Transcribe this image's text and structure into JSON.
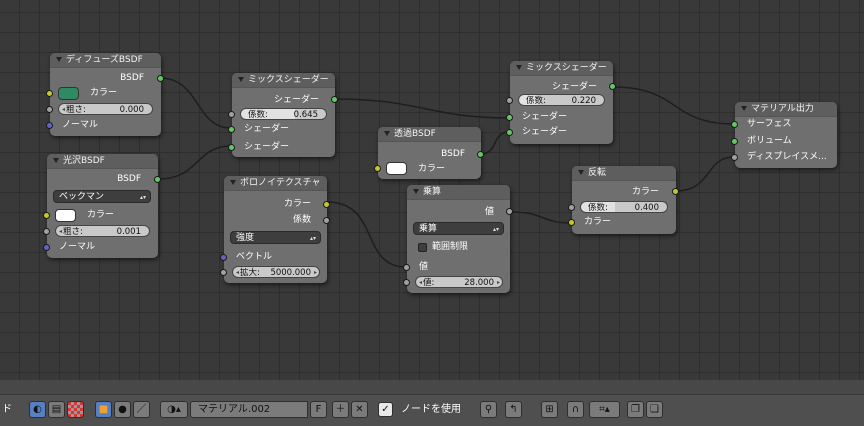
{
  "nodes": {
    "diffuse": {
      "title": "ディフューズBSDF",
      "out_bsdf": "BSDF",
      "color_label": "カラー",
      "color_value": "#2f8a62",
      "rough_label": "粗さ:",
      "rough_value": "0.000",
      "normal_label": "ノーマル"
    },
    "glossy": {
      "title": "光沢BSDF",
      "out_bsdf": "BSDF",
      "dist_value": "ベックマン",
      "color_label": "カラー",
      "color_value": "#ffffff",
      "rough_label": "粗さ:",
      "rough_value": "0.001",
      "normal_label": "ノーマル"
    },
    "mix1": {
      "title": "ミックスシェーダー",
      "out_shader": "シェーダー",
      "fac_label": "係数:",
      "fac_value": "0.645",
      "in_shader1": "シェーダー",
      "in_shader2": "シェーダー"
    },
    "transparent": {
      "title": "透過BSDF",
      "out_bsdf": "BSDF",
      "color_label": "カラー",
      "color_value": "#ffffff"
    },
    "mix2": {
      "title": "ミックスシェーダー",
      "out_shader": "シェーダー",
      "fac_label": "係数:",
      "fac_value": "0.220",
      "in_shader1": "シェーダー",
      "in_shader2": "シェーダー"
    },
    "output": {
      "title": "マテリアル出力",
      "in_surface": "サーフェス",
      "in_volume": "ボリューム",
      "in_displacement": "ディスプレイスメ..."
    },
    "voronoi": {
      "title": "ボロノイテクスチャ",
      "out_color": "カラー",
      "out_fac": "係数",
      "coloring_value": "強度",
      "in_vector": "ベクトル",
      "scale_label": "拡大:",
      "scale_value": "5000.000"
    },
    "math": {
      "title": "乗算",
      "out_value": "値",
      "op_value": "乗算",
      "clamp_label": "範囲制限",
      "clamp_checked": false,
      "in_value": "値",
      "value_label": "値:",
      "value_value": "28.000"
    },
    "invert": {
      "title": "反転",
      "out_color": "カラー",
      "fac_label": "係数:",
      "fac_value": "0.400",
      "in_color": "カラー"
    }
  },
  "header": {
    "mode_fragment": "ド",
    "material_name": "マテリアル.002",
    "fake_user": "F",
    "use_nodes_label": "ノードを使用",
    "use_nodes_checked": true
  },
  "icons": [
    "editor-type-icon",
    "shader-icon",
    "texture-icon",
    "compositing-icon",
    "object-icon",
    "world-icon",
    "linestyle-icon",
    "material-browse-icon",
    "add-icon",
    "close-icon",
    "pin-icon",
    "go-parent-icon",
    "backdrop-icon",
    "snap-icon",
    "snap-element-icon",
    "copy-icon",
    "paste-icon"
  ],
  "colors": {
    "grid_bg": "#393939",
    "node_body": "#6f6f6f",
    "socket_shader": "#63c763",
    "socket_color": "#c7c729",
    "socket_float": "#a1a1a1",
    "socket_vector": "#6363c7",
    "active_blue": "#5680c2"
  }
}
